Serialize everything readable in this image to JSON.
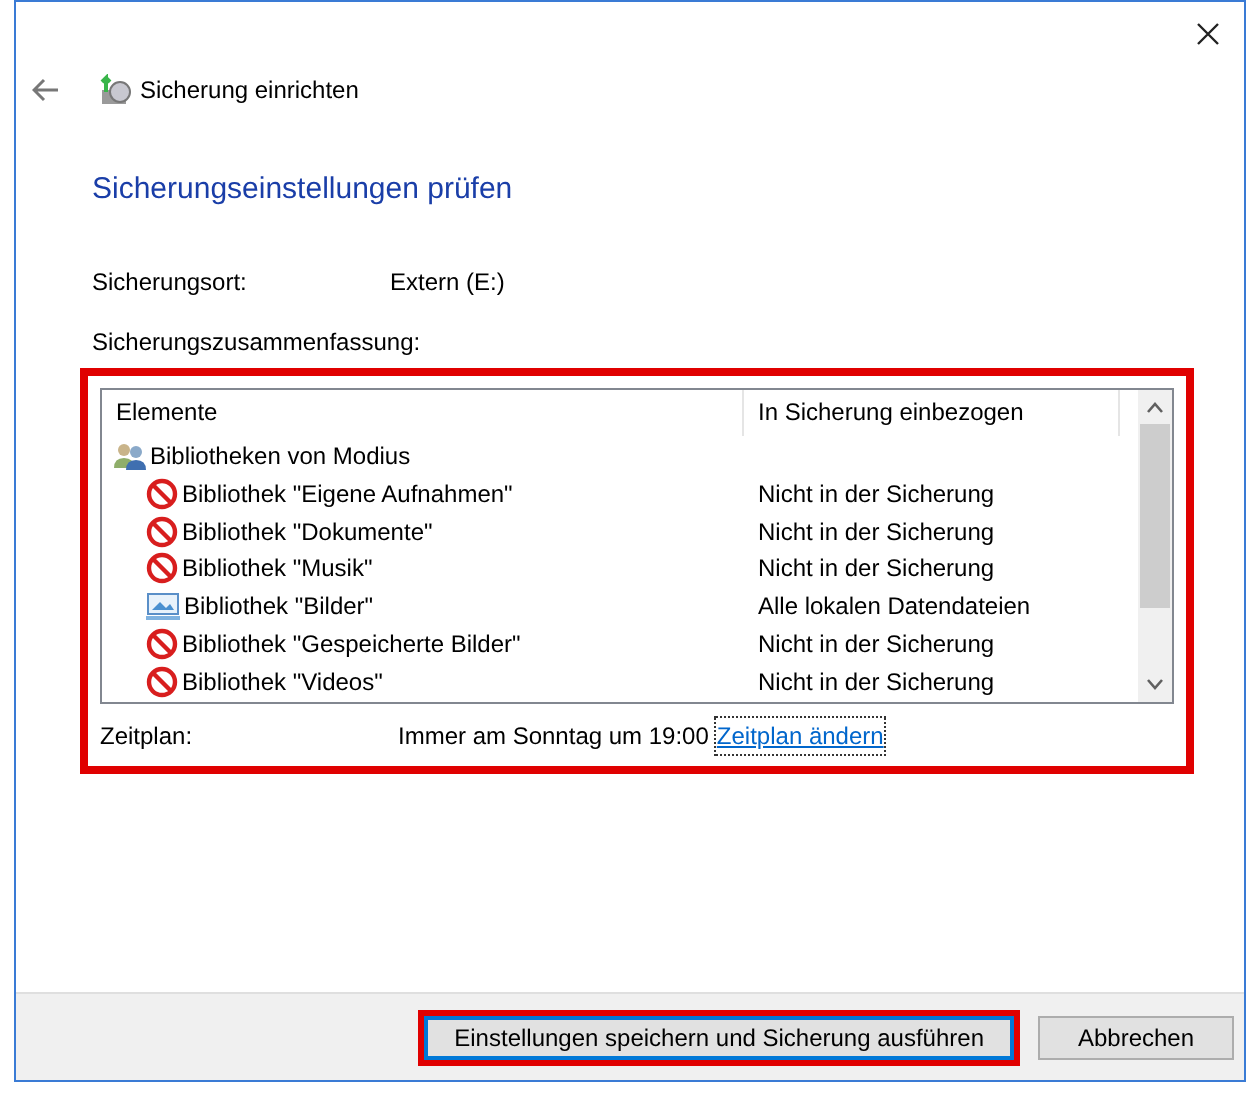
{
  "window": {
    "title": "Sicherung einrichten"
  },
  "heading": "Sicherungseinstellungen prüfen",
  "location": {
    "label": "Sicherungsort:",
    "value": "Extern (E:)"
  },
  "summary": {
    "label": "Sicherungszusammenfassung:",
    "highlighted": true,
    "columns": [
      "Elemente",
      "In Sicherung einbezogen"
    ],
    "rows": [
      {
        "kind": "group",
        "name": "Bibliotheken von Modius",
        "status": ""
      },
      {
        "kind": "excluded",
        "name": "Bibliothek \"Eigene Aufnahmen\"",
        "status": "Nicht in der Sicherung"
      },
      {
        "kind": "excluded",
        "name": "Bibliothek \"Dokumente\"",
        "status": "Nicht in der Sicherung"
      },
      {
        "kind": "excluded",
        "name": "Bibliothek \"Musik\"",
        "status": "Nicht in der Sicherung"
      },
      {
        "kind": "included",
        "name": "Bibliothek \"Bilder\"",
        "status": "Alle lokalen Datendateien"
      },
      {
        "kind": "excluded",
        "name": "Bibliothek \"Gespeicherte Bilder\"",
        "status": "Nicht in der Sicherung"
      },
      {
        "kind": "excluded",
        "name": "Bibliothek \"Videos\"",
        "status": "Nicht in der Sicherung"
      }
    ]
  },
  "schedule": {
    "label": "Zeitplan:",
    "value": "Immer am Sonntag um 19:00",
    "link": "Zeitplan ändern"
  },
  "buttons": [
    {
      "label": "Einstellungen speichern und Sicherung ausführen",
      "primary": true,
      "highlighted": true
    },
    {
      "label": "Abbrechen",
      "primary": false,
      "highlighted": false
    }
  ]
}
